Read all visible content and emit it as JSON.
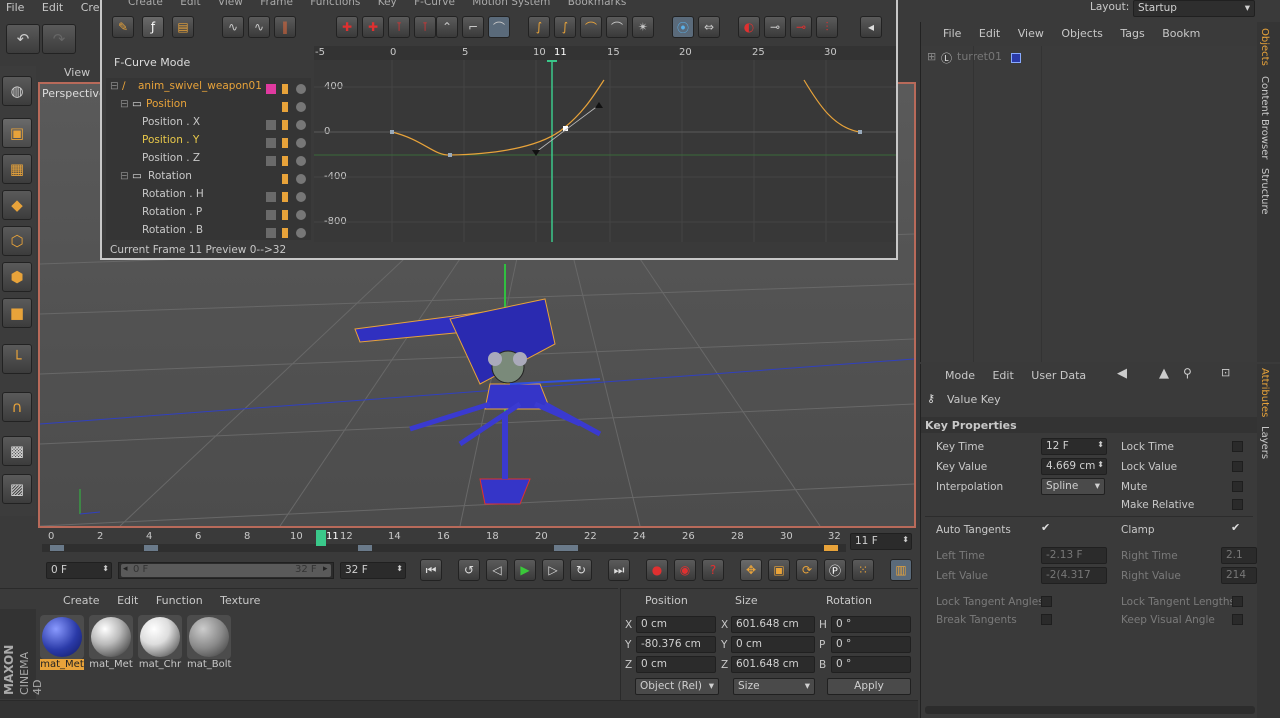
{
  "main_menu": [
    "File",
    "Edit",
    "Create"
  ],
  "layout": {
    "label": "Layout:",
    "value": "Startup"
  },
  "fcurve": {
    "menu": [
      "Create",
      "Edit",
      "View",
      "Frame",
      "Functions",
      "Key",
      "F-Curve",
      "Motion System",
      "Bookmarks"
    ],
    "mode_label": "F-Curve Mode",
    "tree": [
      {
        "label": "anim_swivel_weapon01",
        "level": 0,
        "active": true
      },
      {
        "label": "Position",
        "level": 1,
        "active": true
      },
      {
        "label": "Position . X",
        "level": 2,
        "active": false
      },
      {
        "label": "Position . Y",
        "level": 2,
        "active": true
      },
      {
        "label": "Position . Z",
        "level": 2,
        "active": false
      },
      {
        "label": "Rotation",
        "level": 1,
        "active": false
      },
      {
        "label": "Rotation . H",
        "level": 2,
        "active": false
      },
      {
        "label": "Rotation . P",
        "level": 2,
        "active": false
      },
      {
        "label": "Rotation . B",
        "level": 2,
        "active": false
      }
    ],
    "frame_ticks": [
      "-5",
      "0",
      "5",
      "10",
      "11",
      "15",
      "20",
      "25",
      "30"
    ],
    "value_ticks": [
      "400",
      "0",
      "-400",
      "-800"
    ],
    "status": "Current Frame  11  Preview  0-->32"
  },
  "viewport": {
    "view_menu": "View",
    "perspective_label": "Perspective"
  },
  "objects_panel": {
    "menu": [
      "File",
      "Edit",
      "View",
      "Objects",
      "Tags",
      "Bookm"
    ],
    "object_name": "turret01",
    "side_tabs": [
      "Objects",
      "Content Browser",
      "Structure"
    ]
  },
  "attributes": {
    "menu": [
      "Mode",
      "Edit",
      "User Data"
    ],
    "header": "Value Key",
    "section": "Key Properties",
    "key_time_label": "Key Time",
    "key_time": "12 F",
    "key_value_label": "Key Value",
    "key_value": "4.669 cm",
    "interpolation_label": "Interpolation",
    "interpolation": "Spline",
    "lock_time": "Lock Time",
    "lock_value": "Lock Value",
    "mute": "Mute",
    "make_relative": "Make Relative",
    "auto_tangents": "Auto Tangents",
    "clamp": "Clamp",
    "left_time_label": "Left  Time",
    "left_time": "-2.13 F",
    "left_value_label": "Left  Value",
    "left_value": "-2(4.317",
    "right_time_label": "Right Time",
    "right_time": "2.1",
    "right_value_label": "Right Value",
    "right_value": "214",
    "lock_tangent_angles": "Lock Tangent Angles",
    "lock_tangent_lengths": "Lock Tangent Lengths",
    "break_tangents": "Break Tangents",
    "keep_visual_angle": "Keep Visual Angle",
    "side_tabs": [
      "Attributes",
      "Layers"
    ]
  },
  "timeline": {
    "ticks": [
      "0",
      "2",
      "4",
      "6",
      "8",
      "10",
      "11",
      "12",
      "14",
      "16",
      "18",
      "20",
      "22",
      "24",
      "26",
      "28",
      "30",
      "32"
    ],
    "current_frame": "11 F",
    "start": "0 F",
    "range_start": "0 F",
    "range_end": "32 F",
    "end": "32 F"
  },
  "materials": {
    "menu": [
      "Create",
      "Edit",
      "Function",
      "Texture"
    ],
    "items": [
      {
        "label": "mat_Met",
        "color": "#2a3aa8",
        "selected": true
      },
      {
        "label": "mat_Met",
        "color": "#d8d8d8",
        "selected": false
      },
      {
        "label": "mat_Chr",
        "color": "#e0e0e0",
        "selected": false
      },
      {
        "label": "mat_Bolt",
        "color": "#9a9a9a",
        "selected": false
      }
    ],
    "brand": "MAXON",
    "brand2": "CINEMA 4D"
  },
  "coordinates": {
    "headers": [
      "Position",
      "Size",
      "Rotation"
    ],
    "rows": [
      {
        "axis": "X",
        "pos": "0 cm",
        "saxis": "X",
        "size": "601.648 cm",
        "raxis": "H",
        "rot": "0 °"
      },
      {
        "axis": "Y",
        "pos": "-80.376 cm",
        "saxis": "Y",
        "size": "0 cm",
        "raxis": "P",
        "rot": "0 °"
      },
      {
        "axis": "Z",
        "pos": "0 cm",
        "saxis": "Z",
        "size": "601.648 cm",
        "raxis": "B",
        "rot": "0 °"
      }
    ],
    "mode": "Object (Rel)",
    "size_mode": "Size",
    "apply": "Apply"
  }
}
